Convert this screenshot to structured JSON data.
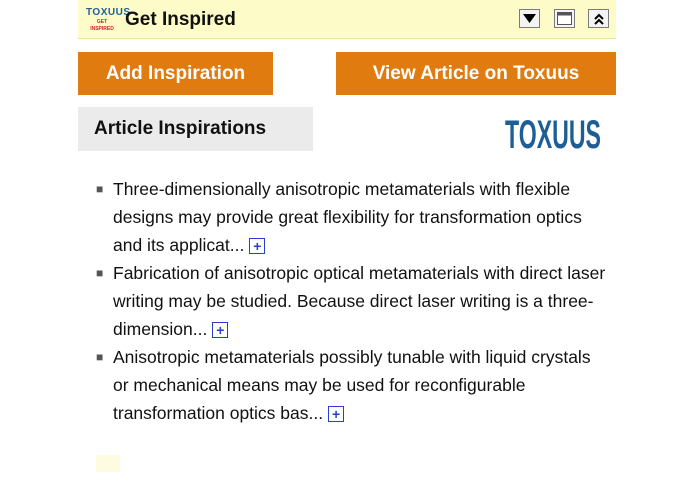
{
  "header": {
    "title": "Get Inspired",
    "logo_top": "TOXUUS",
    "logo_bottom": "GET INSPIRED"
  },
  "buttons": {
    "add_inspiration": "Add Inspiration",
    "view_article": "View Article on Toxuus"
  },
  "section": {
    "title": "Article Inspirations",
    "brand_logo": "TOXUUS"
  },
  "inspirations": [
    {
      "text": "Three-dimensionally anisotropic metamaterials with flexible designs may provide great flexibility for transformation optics and its applicat...",
      "expand": "+"
    },
    {
      "text": "Fabrication of anisotropic optical metamaterials with direct laser writing may be studied. Because direct laser writing is a three-dimension...",
      "expand": "+"
    },
    {
      "text": "Anisotropic metamaterials possibly tunable with liquid crystals or mechanical means may be used for reconfigurable transformation optics bas...",
      "expand": "+"
    }
  ],
  "colors": {
    "titlebar_bg": "#fdfbc8",
    "accent_orange": "#e07b10",
    "logo_blue": "#1d5f95",
    "expand_blue": "#2a3fd0"
  },
  "icons": {
    "minimize": "triangle-down-icon",
    "maximize": "window-icon",
    "collapse": "double-chevron-up-icon"
  }
}
